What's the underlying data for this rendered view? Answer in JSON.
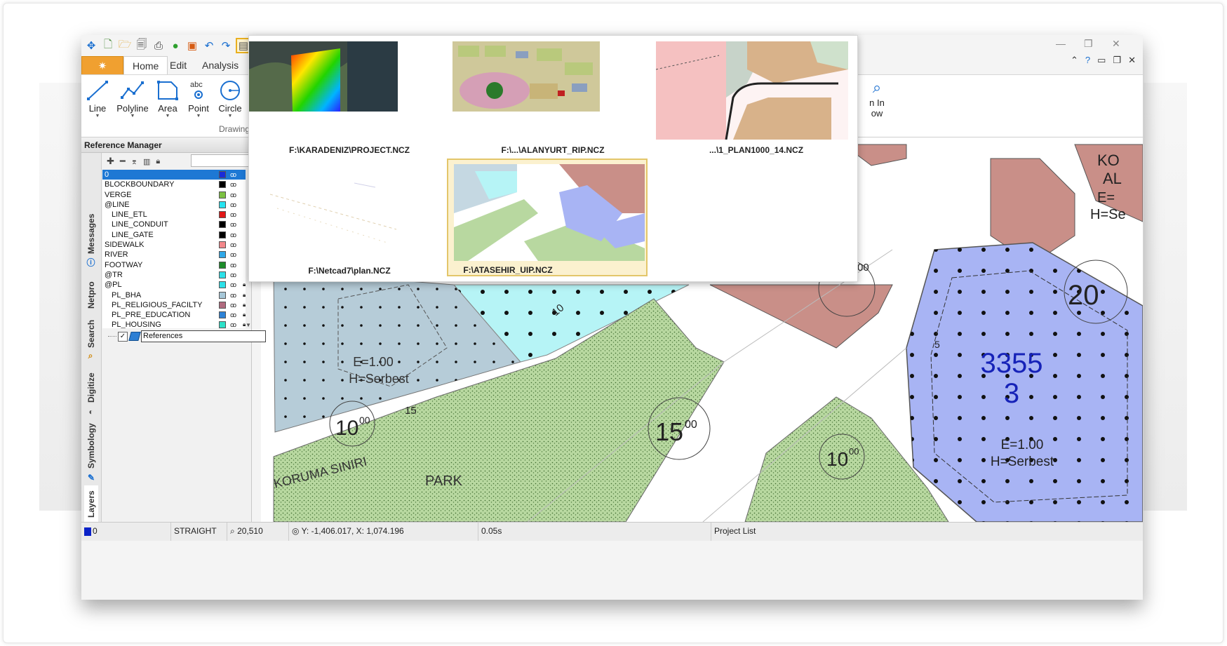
{
  "window": {
    "tabs": [
      "Home",
      "Edit",
      "Analysis"
    ],
    "active_tab": "Home",
    "ribbon_buttons": [
      "Line",
      "Polyline",
      "Area",
      "Point",
      "Circle"
    ],
    "point_caption": "abc",
    "group_label": "Drawing",
    "zoom_button_lines": [
      "n In",
      "ow"
    ]
  },
  "reference_manager": {
    "title": "Reference Manager",
    "side_tabs": [
      "Messages",
      "Netpro",
      "Search",
      "Digitize",
      "Symbology",
      "Layers"
    ],
    "layers": [
      {
        "name": "0",
        "color": "#1a2bd8",
        "selected": true,
        "indent": false,
        "locked": false
      },
      {
        "name": "BLOCKBOUNDARY",
        "color": "#000000",
        "selected": false,
        "indent": false,
        "locked": false
      },
      {
        "name": "VERGE",
        "color": "#7dc142",
        "selected": false,
        "indent": false,
        "locked": false
      },
      {
        "name": "@LINE",
        "color": "#27e3f0",
        "selected": false,
        "indent": false,
        "locked": false
      },
      {
        "name": "LINE_ETL",
        "color": "#e01616",
        "selected": false,
        "indent": true,
        "locked": false
      },
      {
        "name": "LINE_CONDUIT",
        "color": "#000000",
        "selected": false,
        "indent": true,
        "locked": false
      },
      {
        "name": "LINE_GATE",
        "color": "#000000",
        "selected": false,
        "indent": true,
        "locked": false
      },
      {
        "name": "SIDEWALK",
        "color": "#f2878a",
        "selected": false,
        "indent": false,
        "locked": false
      },
      {
        "name": "RIVER",
        "color": "#2fa8e8",
        "selected": false,
        "indent": false,
        "locked": false
      },
      {
        "name": "FOOTWAY",
        "color": "#1d8c2a",
        "selected": false,
        "indent": false,
        "locked": false
      },
      {
        "name": "@TR",
        "color": "#2ce0e8",
        "selected": false,
        "indent": false,
        "locked": false
      },
      {
        "name": "@PL",
        "color": "#2ce0e8",
        "selected": false,
        "indent": false,
        "locked": true
      },
      {
        "name": "PL_BHA",
        "color": "#a6c7d8",
        "selected": false,
        "indent": true,
        "locked": true
      },
      {
        "name": "PL_RELIGIOUS_FACILTY",
        "color": "#b06a7e",
        "selected": false,
        "indent": true,
        "locked": true
      },
      {
        "name": "PL_PRE_EDUCATION",
        "color": "#2d82d6",
        "selected": false,
        "indent": true,
        "locked": true
      },
      {
        "name": "PL_HOUSING",
        "color": "#2ce0c8",
        "selected": false,
        "indent": true,
        "locked": true
      }
    ],
    "reference_item": "References"
  },
  "status_bar": {
    "layer": "0",
    "mode": "STRAIGHT",
    "scale": "20,510",
    "coords": "Y: -1,406.017, X: 1,074.196",
    "time": "0.05s",
    "panel": "Project List"
  },
  "project_list": [
    {
      "path": "F:\\KARADENIZ\\PROJECT.NCZ",
      "selected": false
    },
    {
      "path": "F:\\...\\ALANYURT_RIP.NCZ",
      "selected": false
    },
    {
      "path": "...\\1_PLAN1000_14.NCZ",
      "selected": false
    },
    {
      "path": "F:\\Netcad7\\plan.NCZ",
      "selected": false
    },
    {
      "path": "F:\\ATASEHIR_UIP.NCZ",
      "selected": true
    }
  ],
  "map_labels": {
    "parcel_number": "3355",
    "parcel_block": "3",
    "e_value": "E=1.00",
    "h_value": "H=Serbest",
    "left_e": "E=1.00",
    "left_h": "H=Serbest",
    "road_width_1": "10",
    "road_width_1_sup": "00",
    "road_width_2": "15",
    "road_width_2_sup": "00",
    "road_width_3": "10",
    "road_width_3_sup": "00",
    "road_width_4": "20",
    "road_width_4_sup": "00",
    "park": "PARK",
    "koruma": "KORUMA SINIRI",
    "top_right_lines": [
      "KO",
      "AL",
      "E=",
      "H=Se"
    ],
    "setback_5": "5",
    "setback_10": "10",
    "setback_15": "15"
  },
  "colors": {
    "accent_orange": "#f0a030",
    "selection_blue": "#1e78d4",
    "parcel_blue": "#a8b4f4",
    "parcel_red": "#c98f88",
    "park_green": "#b4d49c",
    "cyan_zone": "#b6f4f6"
  }
}
